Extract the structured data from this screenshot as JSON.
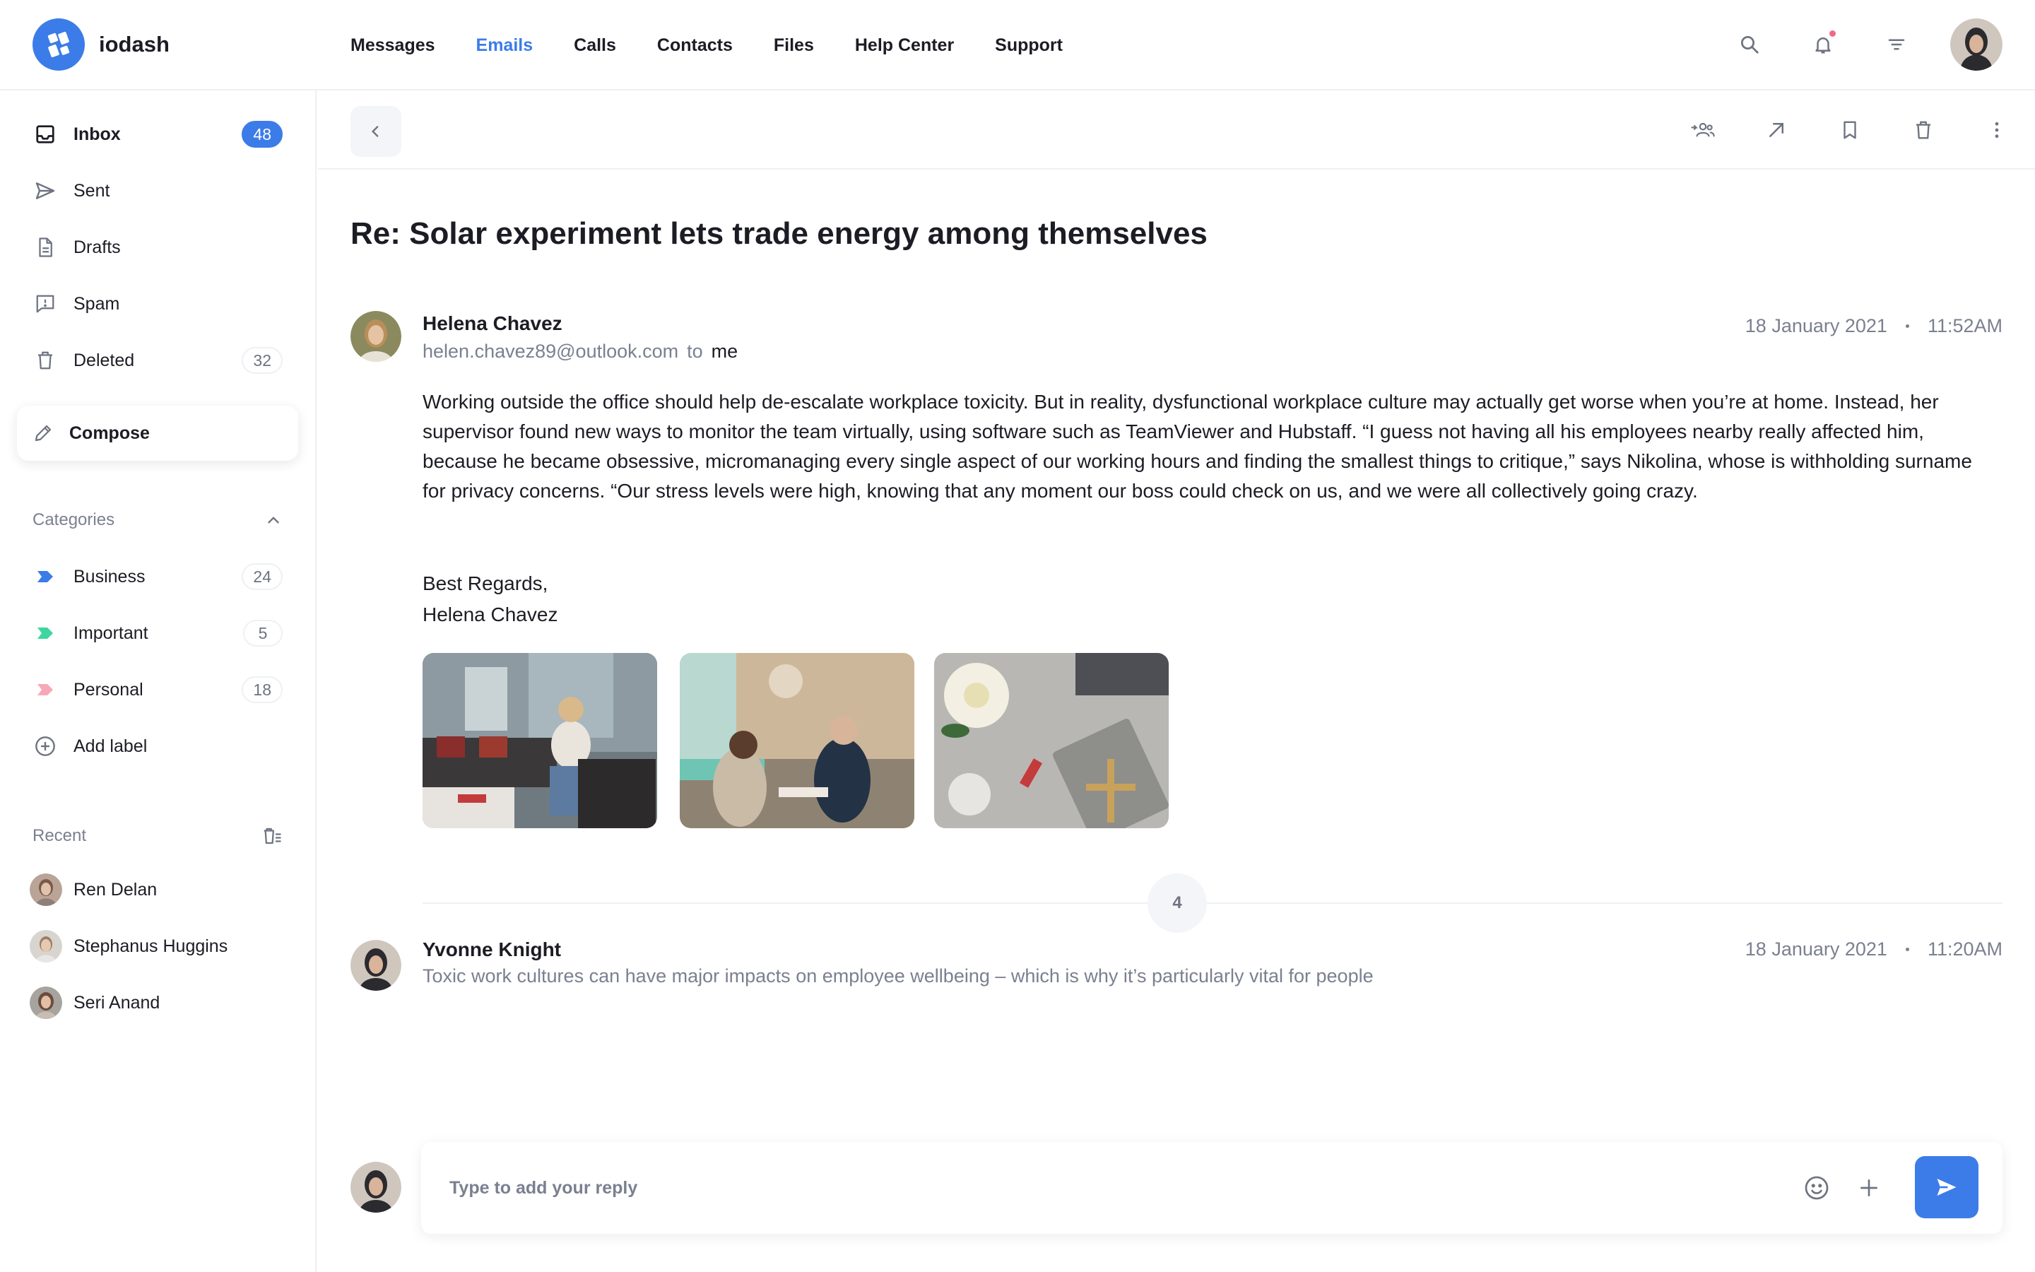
{
  "app": {
    "name": "iodash"
  },
  "nav": {
    "items": [
      {
        "label": "Messages",
        "active": false
      },
      {
        "label": "Emails",
        "active": true
      },
      {
        "label": "Calls",
        "active": false
      },
      {
        "label": "Contacts",
        "active": false
      },
      {
        "label": "Files",
        "active": false
      },
      {
        "label": "Help Center",
        "active": false
      },
      {
        "label": "Support",
        "active": false
      }
    ]
  },
  "header_icons": [
    "search-icon",
    "bell-icon",
    "filter-icon",
    "user-avatar"
  ],
  "sidebar": {
    "folders": [
      {
        "label": "Inbox",
        "count": "48",
        "icon": "inbox-icon",
        "active": true
      },
      {
        "label": "Sent",
        "count": "",
        "icon": "send-icon"
      },
      {
        "label": "Drafts",
        "count": "",
        "icon": "document-icon"
      },
      {
        "label": "Spam",
        "count": "",
        "icon": "spam-icon"
      },
      {
        "label": "Deleted",
        "count": "32",
        "icon": "trash-icon"
      }
    ],
    "compose_label": "Compose",
    "categories_title": "Categories",
    "categories": [
      {
        "label": "Business",
        "count": "24",
        "color": "#3c7ce8"
      },
      {
        "label": "Important",
        "count": "5",
        "color": "#3ed6a0"
      },
      {
        "label": "Personal",
        "count": "18",
        "color": "#f7a8b8"
      }
    ],
    "add_label": "Add label",
    "recent_title": "Recent",
    "recent": [
      {
        "name": "Ren Delan"
      },
      {
        "name": "Stephanus Huggins"
      },
      {
        "name": "Seri Anand"
      }
    ]
  },
  "email": {
    "subject": "Re: Solar experiment lets trade energy among themselves",
    "sender": {
      "name": "Helena Chavez",
      "address": "helen.chavez89@outlook.com",
      "to_word": "to",
      "recipient": "me",
      "date": "18 January 2021",
      "time": "11:52AM"
    },
    "body": "Working outside the office should help de-escalate workplace toxicity. But in reality, dysfunctional workplace culture may actually get worse when you’re at home. Instead, her supervisor found new ways to monitor the team virtually, using software such as TeamViewer and Hubstaff. “I guess not having all his employees nearby really affected him, because he became obsessive, micromanaging every single aspect of our working hours and finding the smallest things to critique,” says Nikolina, whose is withholding surname for privacy concerns. “Our stress levels were high, knowing that any moment our boss could check on us, and we were all collectively going crazy.",
    "signoff": "Best Regards,",
    "signature": "Helena Chavez",
    "attachments": [
      {
        "label": "office-lounge-photo"
      },
      {
        "label": "cafe-meeting-photo"
      },
      {
        "label": "desk-flatlay-photo"
      }
    ],
    "collapsed_count": "4"
  },
  "previous_email": {
    "sender": "Yvonne Knight",
    "preview": "Toxic work cultures can have major impacts on employee wellbeing – which is why it’s particularly vital for people",
    "date": "18 January 2021",
    "time": "11:20AM"
  },
  "reply": {
    "placeholder": "Type to add your reply"
  },
  "colors": {
    "accent": "#3c7ce8",
    "text": "#1c1c24",
    "muted": "#7b8090",
    "border": "#eef0f3"
  }
}
